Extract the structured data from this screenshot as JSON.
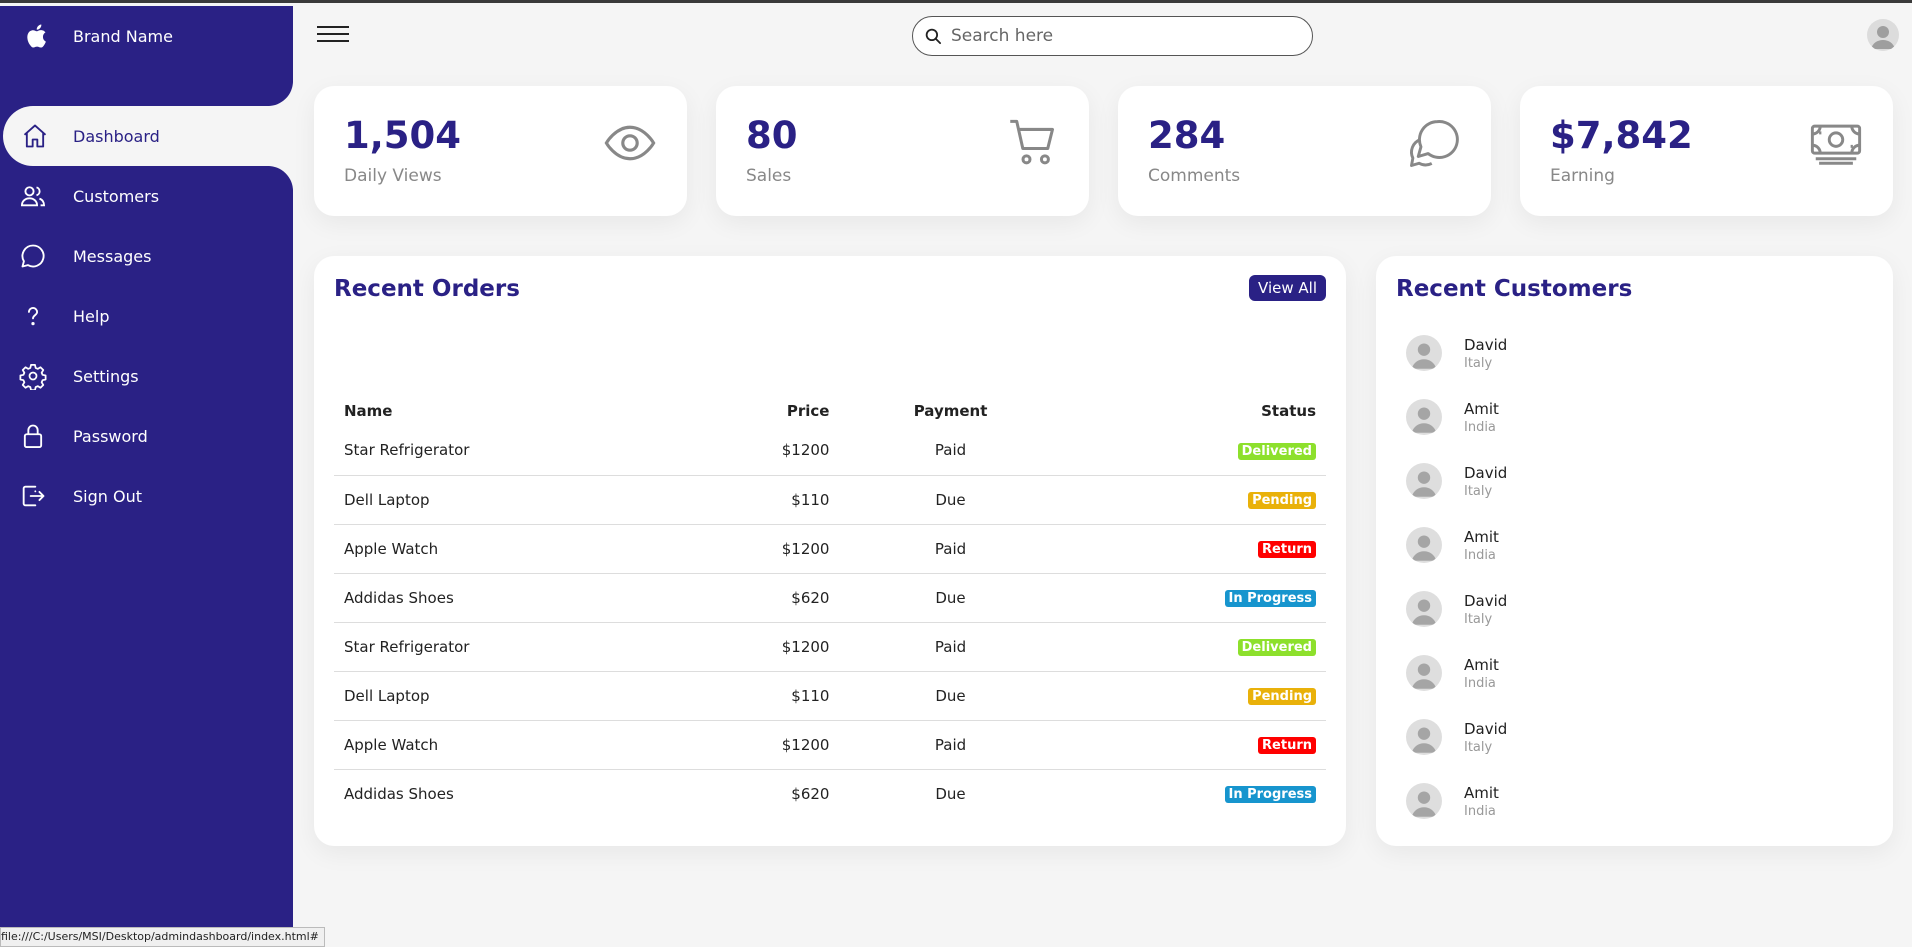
{
  "brand": {
    "name": "Brand Name",
    "icon": "apple-icon"
  },
  "nav": {
    "items": [
      {
        "label": "Dashboard",
        "icon": "home-icon",
        "active": true
      },
      {
        "label": "Customers",
        "icon": "people-icon"
      },
      {
        "label": "Messages",
        "icon": "chat-icon"
      },
      {
        "label": "Help",
        "icon": "help-icon"
      },
      {
        "label": "Settings",
        "icon": "gear-icon"
      },
      {
        "label": "Password",
        "icon": "lock-icon"
      },
      {
        "label": "Sign Out",
        "icon": "sign-out-icon"
      }
    ]
  },
  "topbar": {
    "search_placeholder": "Search here"
  },
  "cards": [
    {
      "number": "1,504",
      "label": "Daily Views",
      "icon": "eye-icon"
    },
    {
      "number": "80",
      "label": "Sales",
      "icon": "cart-icon"
    },
    {
      "number": "284",
      "label": "Comments",
      "icon": "chat-icon"
    },
    {
      "number": "$7,842",
      "label": "Earning",
      "icon": "cash-icon"
    }
  ],
  "orders": {
    "title": "Recent Orders",
    "view_all": "View All",
    "headers": {
      "name": "Name",
      "price": "Price",
      "payment": "Payment",
      "status": "Status"
    },
    "rows": [
      {
        "name": "Star Refrigerator",
        "price": "$1200",
        "payment": "Paid",
        "status": "Delivered"
      },
      {
        "name": "Dell Laptop",
        "price": "$110",
        "payment": "Due",
        "status": "Pending"
      },
      {
        "name": "Apple Watch",
        "price": "$1200",
        "payment": "Paid",
        "status": "Return"
      },
      {
        "name": "Addidas Shoes",
        "price": "$620",
        "payment": "Due",
        "status": "In Progress"
      },
      {
        "name": "Star Refrigerator",
        "price": "$1200",
        "payment": "Paid",
        "status": "Delivered"
      },
      {
        "name": "Dell Laptop",
        "price": "$110",
        "payment": "Due",
        "status": "Pending"
      },
      {
        "name": "Apple Watch",
        "price": "$1200",
        "payment": "Paid",
        "status": "Return"
      },
      {
        "name": "Addidas Shoes",
        "price": "$620",
        "payment": "Due",
        "status": "In Progress"
      }
    ]
  },
  "customers": {
    "title": "Recent Customers",
    "list": [
      {
        "name": "David",
        "country": "Italy"
      },
      {
        "name": "Amit",
        "country": "India"
      },
      {
        "name": "David",
        "country": "Italy"
      },
      {
        "name": "Amit",
        "country": "India"
      },
      {
        "name": "David",
        "country": "Italy"
      },
      {
        "name": "Amit",
        "country": "India"
      },
      {
        "name": "David",
        "country": "Italy"
      },
      {
        "name": "Amit",
        "country": "India"
      }
    ]
  },
  "statusbar": {
    "url": "file:///C:/Users/MSI/Desktop/admindashboard/index.html#"
  },
  "colors": {
    "primary": "#2a2185",
    "delivered": "#8de02c",
    "pending": "#e9b10a",
    "return": "#f00",
    "in_progress": "#1795ce"
  }
}
